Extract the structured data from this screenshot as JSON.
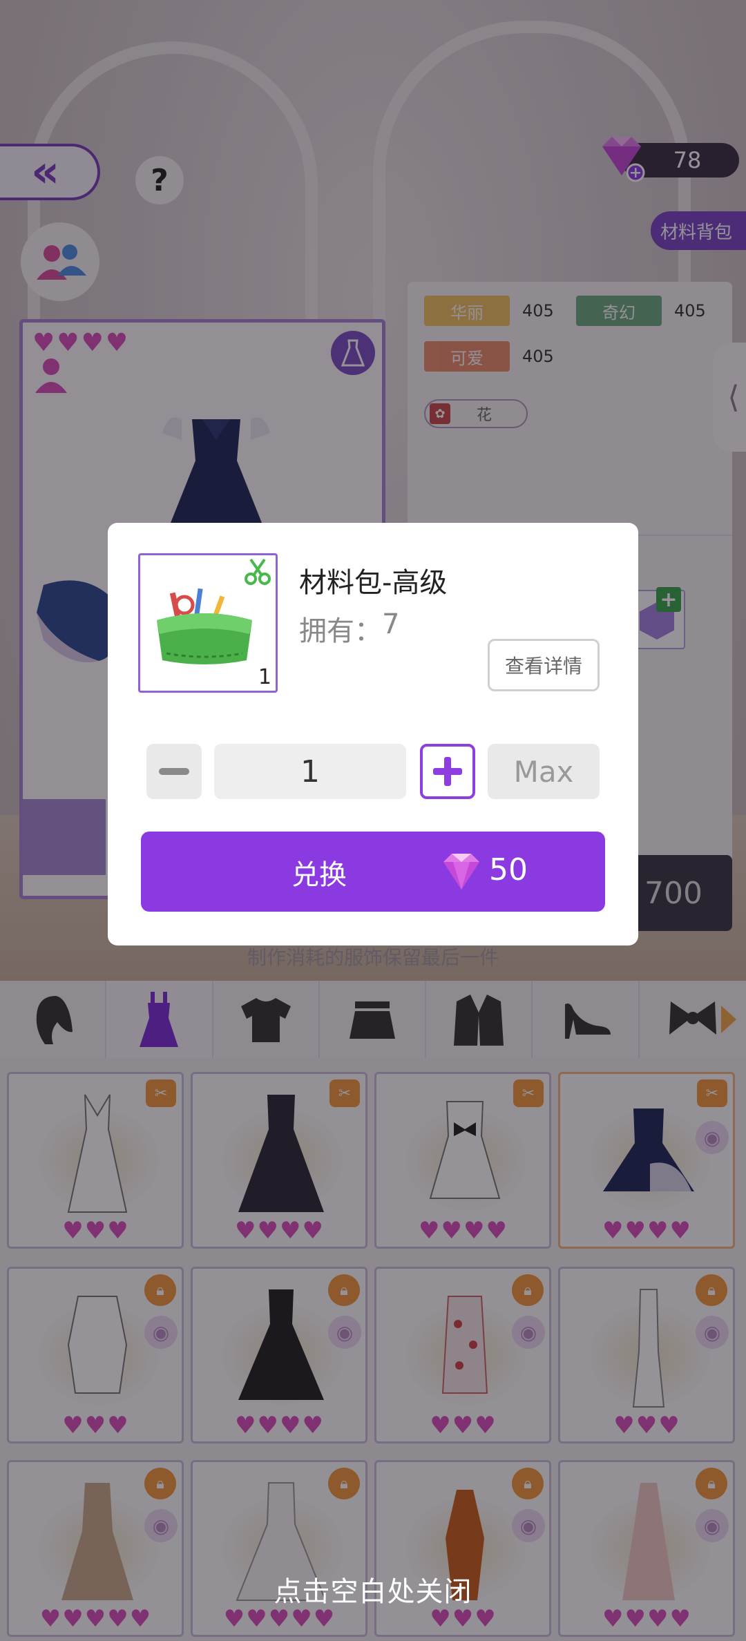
{
  "header": {
    "gem_count": "78",
    "help_glyph": "?",
    "back_glyph": "«",
    "material_bag_label": "材料背包"
  },
  "stats": [
    {
      "label": "华丽",
      "value": "405",
      "color": "#f0b63a"
    },
    {
      "label": "奇幻",
      "value": "405",
      "color": "#4a9a63"
    },
    {
      "label": "可爱",
      "value": "405",
      "color": "#e8754a"
    }
  ],
  "material_chip": {
    "label": "花"
  },
  "craft_cost_hint": "700",
  "craft_note": "制作消耗的服饰保留最后一件",
  "categories": [
    "hair-icon",
    "dress-icon",
    "top-icon",
    "skirt-icon",
    "coat-icon",
    "shoe-icon",
    "bow-icon"
  ],
  "grid_items": [
    {
      "hearts": 3,
      "badge": "sewing"
    },
    {
      "hearts": 4,
      "badge": "sewing"
    },
    {
      "hearts": 4,
      "badge": "sewing"
    },
    {
      "hearts": 4,
      "badge": "sewing",
      "selected": true
    },
    {
      "hearts": 3,
      "badge": "lock"
    },
    {
      "hearts": 4,
      "badge": "lock"
    },
    {
      "hearts": 3,
      "badge": "lock"
    },
    {
      "hearts": 3,
      "badge": "lock"
    },
    {
      "hearts": 5,
      "badge": "lock"
    },
    {
      "hearts": 5,
      "badge": "lock"
    },
    {
      "hearts": 3,
      "badge": "lock"
    },
    {
      "hearts": 4,
      "badge": "lock"
    }
  ],
  "modal": {
    "item_name": "材料包-高级",
    "owned_label": "拥有：",
    "owned_count": "7",
    "thumb_count": "1",
    "detail_button": "查看详情",
    "quantity": "1",
    "max_label": "Max",
    "exchange_label": "兑换",
    "price": "50"
  },
  "close_hint": "点击空白处关闭",
  "colors": {
    "accent": "#8b3ae2",
    "heart": "#d94fb9"
  }
}
